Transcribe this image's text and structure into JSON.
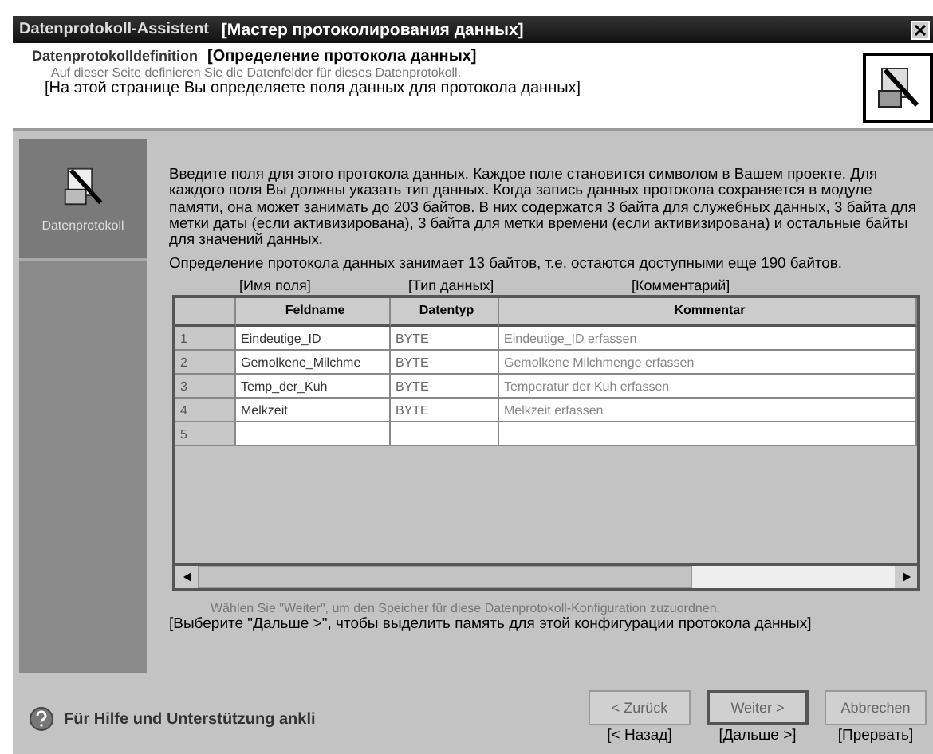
{
  "window": {
    "title": "Datenprotokoll-Assistent",
    "title_translation": "[Мастер протоколирования данных]"
  },
  "header": {
    "title": "Datenprotokolldefinition",
    "title_translation": "[Определение протокола данных]",
    "subtitle": "Auf dieser Seite definieren Sie die Datenfelder für dieses Datenprotokoll.",
    "subtitle_translation": "[На этой странице Вы определяете поля данных для протокола данных]"
  },
  "sidebar": {
    "items": [
      {
        "label": "Datenprotokoll",
        "selected": true
      }
    ]
  },
  "paragraphs": [
    "Введите поля для этого протокола данных. Каждое поле становится символом в Вашем проекте. Для каждого поля Вы должны указать тип данных. Когда запись данных протокола сохраняется в модуле памяти, она может занимать до 203 байтов. В них содержатся 3 байта для служебных данных, 3 байта для метки даты (если активизирована), 3 байта для метки времени (если активизирована) и остальные байты для значений данных.",
    "Определение протокола данных занимает 13 байтов, т.е. остаются доступными еще 190 байтов."
  ],
  "table": {
    "column_translations": [
      "[Имя поля]",
      "[Тип данных]",
      "[Комментарий]"
    ],
    "columns": [
      "Feldname",
      "Datentyp",
      "Kommentar"
    ],
    "rows": [
      {
        "number": "1",
        "cells": [
          "Eindeutige_ID",
          "BYTE",
          "Eindeutige_ID erfassen"
        ]
      },
      {
        "number": "2",
        "cells": [
          "Gemolkene_Milchme",
          "BYTE",
          "Gemolkene Milchmenge erfassen"
        ]
      },
      {
        "number": "3",
        "cells": [
          "Temp_der_Kuh",
          "BYTE",
          "Temperatur der Kuh erfassen"
        ]
      },
      {
        "number": "4",
        "cells": [
          "Melkzeit",
          "BYTE",
          "Melkzeit erfassen"
        ]
      },
      {
        "number": "5",
        "cells": []
      }
    ]
  },
  "hint": "Wählen Sie \"Weiter\", um den Speicher für diese Datenprotokoll-Konfiguration zuzuordnen.",
  "hint_translation": "[Выберите \"Дальше >\", чтобы выделить память для этой конфигурации протокола данных]",
  "footer": {
    "help": "Für Hilfe und Unterstützung ankli",
    "buttons": [
      {
        "label": "< Zurück",
        "translation": "[< Назад]",
        "default": false
      },
      {
        "label": "Weiter >",
        "translation": "[Дальше >]",
        "default": true
      },
      {
        "label": "Abbrechen",
        "translation": "[Прервать]",
        "default": false
      }
    ]
  }
}
